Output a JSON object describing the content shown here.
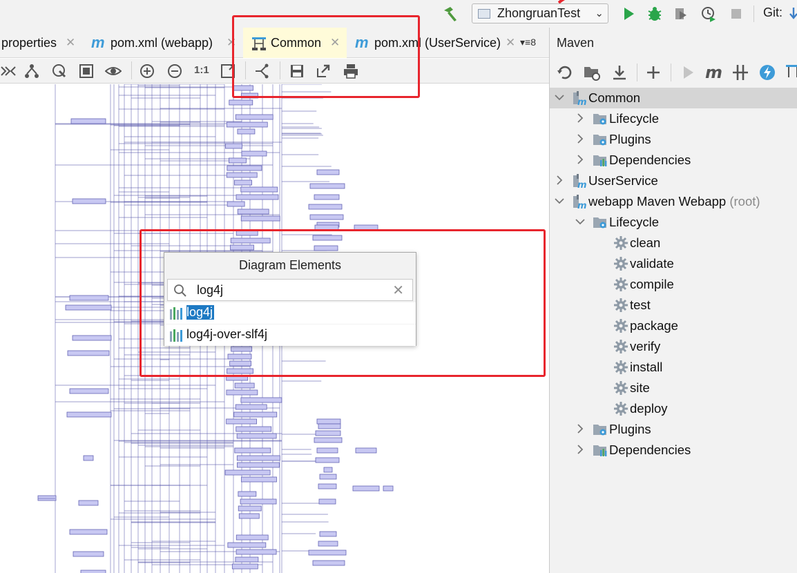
{
  "toolbar": {
    "run_config": "ZhongruanTest",
    "git_label": "Git:"
  },
  "editor_tabs": [
    {
      "label": "properties",
      "kind": "properties",
      "active": false
    },
    {
      "label": "pom.xml (webapp)",
      "kind": "maven",
      "active": false
    },
    {
      "label": "Common",
      "kind": "diagram",
      "active": true
    },
    {
      "label": "pom.xml (UserService)",
      "kind": "maven",
      "active": false
    }
  ],
  "tab_overflow": "8",
  "diagram_toolbar": {
    "zoom_actual": "1:1"
  },
  "maven": {
    "title": "Maven",
    "tree": [
      {
        "label": "Common",
        "level": 0,
        "expanded": true,
        "icon": "maven-module-icon",
        "selected": true
      },
      {
        "label": "Lifecycle",
        "level": 1,
        "expanded": false,
        "icon": "lifecycle-folder-icon"
      },
      {
        "label": "Plugins",
        "level": 1,
        "expanded": false,
        "icon": "plugins-folder-icon"
      },
      {
        "label": "Dependencies",
        "level": 1,
        "expanded": false,
        "icon": "dependencies-folder-icon"
      },
      {
        "label": "UserService",
        "level": 0,
        "expanded": false,
        "icon": "maven-module-icon"
      },
      {
        "label": "webapp Maven Webapp",
        "suffix": "(root)",
        "level": 0,
        "expanded": true,
        "icon": "maven-module-icon"
      },
      {
        "label": "Lifecycle",
        "level": 1,
        "expanded": true,
        "icon": "lifecycle-folder-icon"
      },
      {
        "label": "clean",
        "level": 2,
        "icon": "gear-icon"
      },
      {
        "label": "validate",
        "level": 2,
        "icon": "gear-icon"
      },
      {
        "label": "compile",
        "level": 2,
        "icon": "gear-icon"
      },
      {
        "label": "test",
        "level": 2,
        "icon": "gear-icon"
      },
      {
        "label": "package",
        "level": 2,
        "icon": "gear-icon"
      },
      {
        "label": "verify",
        "level": 2,
        "icon": "gear-icon"
      },
      {
        "label": "install",
        "level": 2,
        "icon": "gear-icon"
      },
      {
        "label": "site",
        "level": 2,
        "icon": "gear-icon"
      },
      {
        "label": "deploy",
        "level": 2,
        "icon": "gear-icon"
      },
      {
        "label": "Plugins",
        "level": 1,
        "expanded": false,
        "icon": "plugins-folder-icon"
      },
      {
        "label": "Dependencies",
        "level": 1,
        "expanded": false,
        "icon": "dependencies-folder-icon"
      }
    ]
  },
  "popup": {
    "title": "Diagram Elements",
    "search_value": "log4j",
    "results": [
      {
        "label": "log4j",
        "selected": true
      },
      {
        "label": "log4j-over-slf4j",
        "selected": false
      }
    ]
  },
  "colors": {
    "selection": "#1d79c3",
    "annotation_red": "#e8252d",
    "node_fill": "#c8c8f2",
    "node_stroke": "#6464b4",
    "edge": "#5252a8",
    "maven_blue": "#3d9bd8",
    "run_green": "#2aa54a"
  }
}
